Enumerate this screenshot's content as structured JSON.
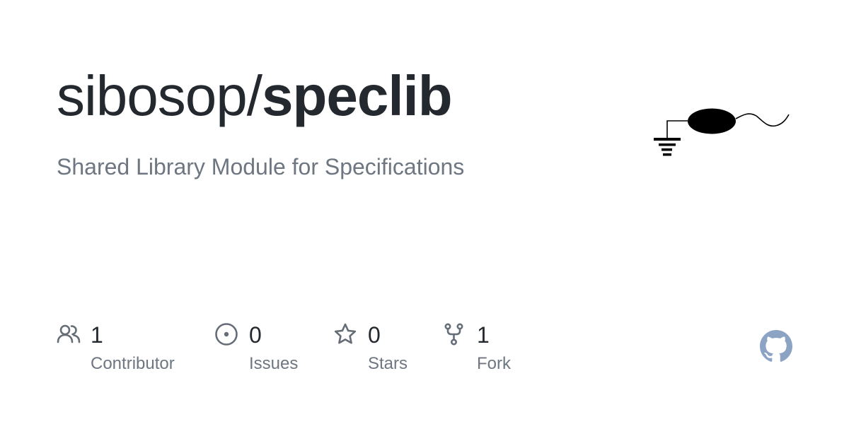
{
  "repo": {
    "owner": "sibosop/",
    "name": "speclib",
    "description": "Shared Library Module for Specifications"
  },
  "stats": [
    {
      "icon": "contributors-icon",
      "count": "1",
      "label": "Contributor"
    },
    {
      "icon": "issues-icon",
      "count": "0",
      "label": "Issues"
    },
    {
      "icon": "star-icon",
      "count": "0",
      "label": "Stars"
    },
    {
      "icon": "fork-icon",
      "count": "1",
      "label": "Fork"
    }
  ],
  "colors": {
    "title": "#24292f",
    "muted": "#6e7681",
    "icon": "#656d76",
    "logo": "#000000",
    "github_mark": "#8ca3c4"
  }
}
